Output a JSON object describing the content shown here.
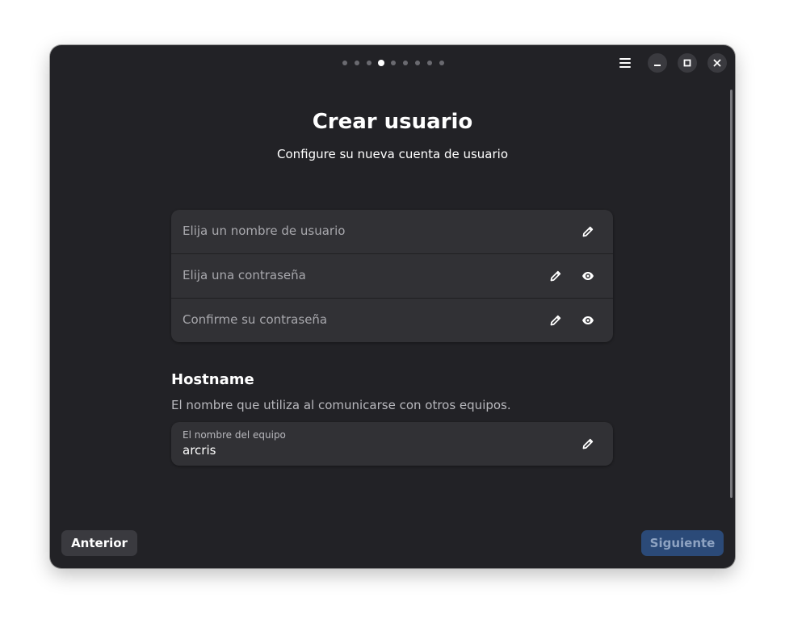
{
  "progress": {
    "steps": 9,
    "current": 4
  },
  "header": {
    "menu_icon": "hamburger-icon",
    "minimize_icon": "minimize-icon",
    "maximize_icon": "maximize-icon",
    "close_icon": "close-icon"
  },
  "page": {
    "title": "Crear usuario",
    "subtitle": "Configure su nueva cuenta de usuario"
  },
  "fields": [
    {
      "placeholder": "Elija un nombre de usuario",
      "icons": [
        "pencil-icon"
      ]
    },
    {
      "placeholder": "Elija una contraseña",
      "icons": [
        "pencil-icon",
        "eye-icon"
      ]
    },
    {
      "placeholder": "Confirme su contraseña",
      "icons": [
        "pencil-icon",
        "eye-icon"
      ]
    }
  ],
  "hostname": {
    "title": "Hostname",
    "description": "El nombre que utiliza al comunicarse con otros equipos.",
    "label": "El nombre del equipo",
    "value": "arcris"
  },
  "footer": {
    "prev_label": "Anterior",
    "next_label": "Siguiente"
  },
  "colors": {
    "window_bg": "#222226",
    "card_bg": "#313135",
    "accent_disabled": "#2b4a78"
  }
}
